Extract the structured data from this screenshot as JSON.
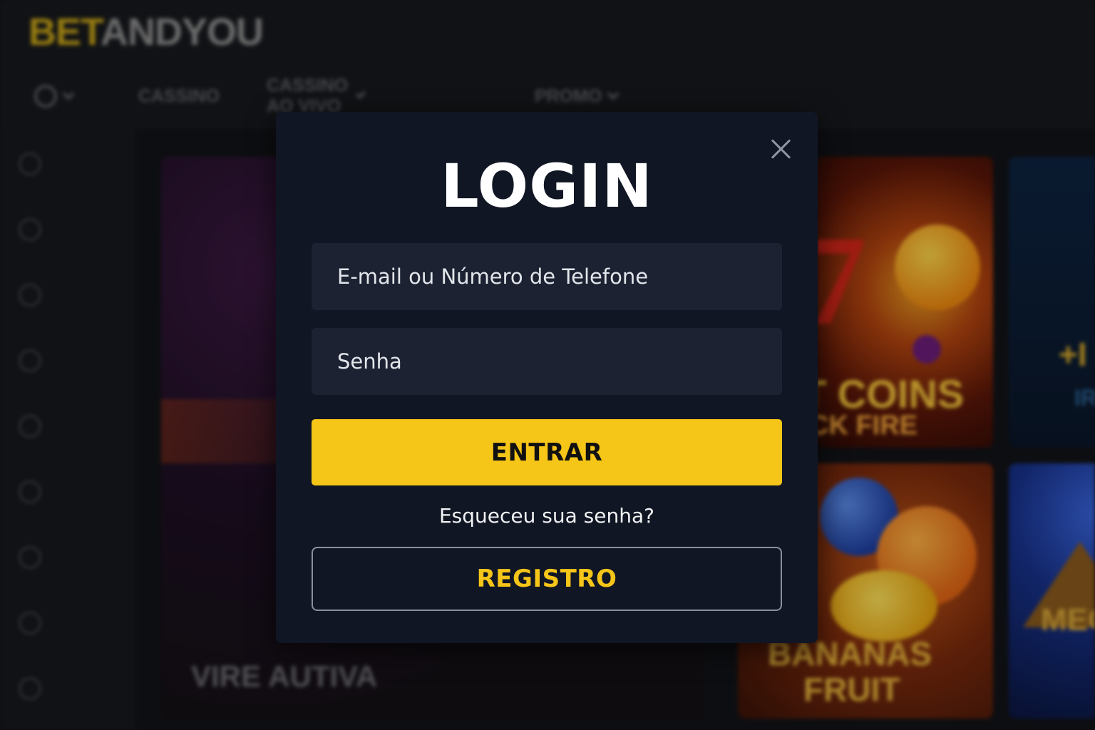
{
  "header": {
    "logo_accent": "BET",
    "logo_rest": "ANDYOU",
    "nav": [
      {
        "label": "CASSINO"
      },
      {
        "label": "CASSINO AO VIVO"
      },
      {
        "label": "PROMO"
      }
    ]
  },
  "banner": {
    "text": "VIRE AUTIVA"
  },
  "tiles": {
    "hot_title_1": "T COINS",
    "hot_title_2": "CK FIRE",
    "fruit_title_1": "BANANAS",
    "fruit_title_2": "FRUIT"
  },
  "login": {
    "title": "LOGIN",
    "email_placeholder": "E-mail ou Número de Telefone",
    "password_placeholder": "Senha",
    "submit_label": "ENTRAR",
    "forgot_label": "Esqueceu sua senha?",
    "register_label": "REGISTRO"
  },
  "colors": {
    "accent": "#f5c518",
    "modal_bg": "#111624",
    "input_bg": "#1c2232"
  }
}
